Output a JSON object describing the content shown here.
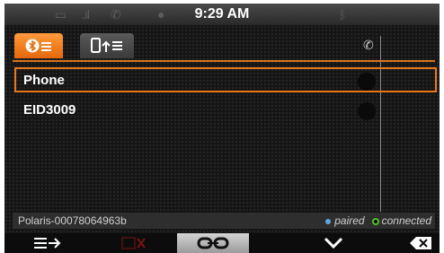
{
  "status_bar": {
    "time": "9:29 AM",
    "icons": [
      "battery-icon",
      "signal-icon",
      "phone-icon",
      "message-icon",
      "bluetooth-icon"
    ]
  },
  "tabs": [
    {
      "name": "paired-devices",
      "icon": "bluetooth-list-icon",
      "active": true
    },
    {
      "name": "sync-devices",
      "icon": "phone-upload-icon",
      "active": false
    }
  ],
  "devices": [
    {
      "label": "Phone",
      "selected": true
    },
    {
      "label": "EID3009",
      "selected": false
    }
  ],
  "footer": {
    "device_id": "Polaris-00078064963b",
    "legend_paired": "paired",
    "legend_connected": "connected"
  },
  "toolbar": [
    {
      "icon": "menu-arrow-icon",
      "active": false
    },
    {
      "icon": "delete-disabled-icon",
      "active": false
    },
    {
      "icon": "link-icon",
      "active": true
    },
    {
      "icon": "chevron-down-icon",
      "active": false
    },
    {
      "icon": "backspace-icon",
      "active": false
    }
  ],
  "colors": {
    "accent": "#e8781a",
    "paired": "#5aa8e6",
    "connected": "#59c02a"
  }
}
